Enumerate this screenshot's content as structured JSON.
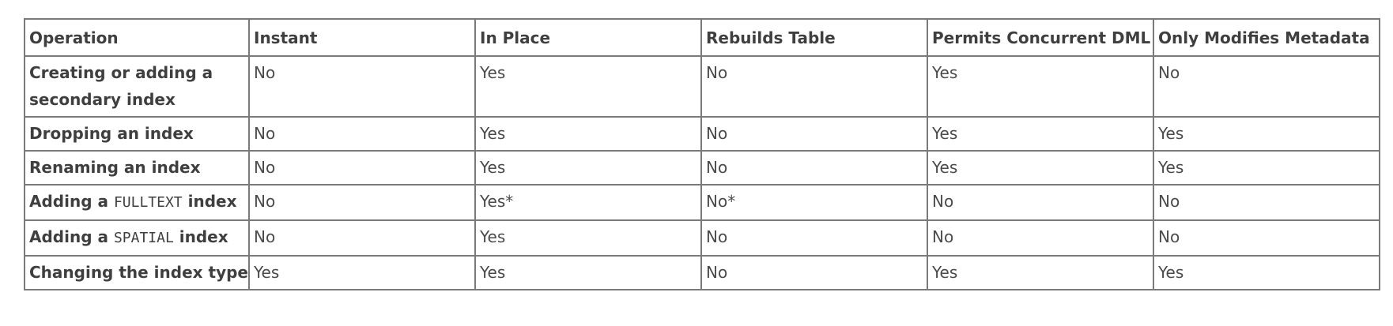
{
  "table": {
    "headers": [
      "Operation",
      "Instant",
      "In Place",
      "Rebuilds Table",
      "Permits Concurrent DML",
      "Only Modifies Metadata"
    ],
    "rows": [
      {
        "operation": {
          "prefix": "Creating or adding a secondary index",
          "code": "",
          "suffix": ""
        },
        "cells": [
          "No",
          "Yes",
          "No",
          "Yes",
          "No"
        ]
      },
      {
        "operation": {
          "prefix": "Dropping an index",
          "code": "",
          "suffix": ""
        },
        "cells": [
          "No",
          "Yes",
          "No",
          "Yes",
          "Yes"
        ]
      },
      {
        "operation": {
          "prefix": "Renaming an index",
          "code": "",
          "suffix": ""
        },
        "cells": [
          "No",
          "Yes",
          "No",
          "Yes",
          "Yes"
        ]
      },
      {
        "operation": {
          "prefix": "Adding a ",
          "code": "FULLTEXT",
          "suffix": " index"
        },
        "cells": [
          "No",
          "Yes*",
          "No*",
          "No",
          "No"
        ]
      },
      {
        "operation": {
          "prefix": "Adding a ",
          "code": "SPATIAL",
          "suffix": " index"
        },
        "cells": [
          "No",
          "Yes",
          "No",
          "No",
          "No"
        ]
      },
      {
        "operation": {
          "prefix": "Changing the index type",
          "code": "",
          "suffix": ""
        },
        "cells": [
          "Yes",
          "Yes",
          "No",
          "Yes",
          "Yes"
        ]
      }
    ]
  }
}
